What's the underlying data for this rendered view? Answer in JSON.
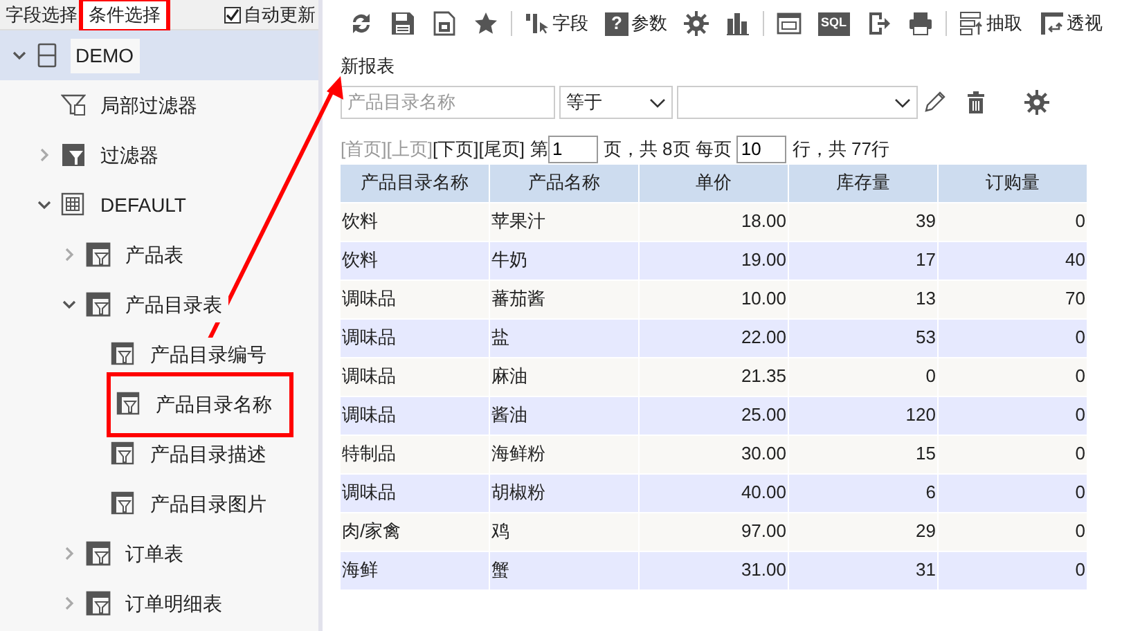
{
  "left_tabs": [
    {
      "label": "字段选择",
      "selected": false,
      "highlighted": false
    },
    {
      "label": "条件选择",
      "selected": true,
      "highlighted": true
    }
  ],
  "auto_update": {
    "label": "自动更新",
    "checked": true
  },
  "tree": [
    {
      "label": "DEMO",
      "kind": "database",
      "expanded": true,
      "selected": true,
      "children": [
        {
          "label": "局部过滤器",
          "kind": "local_filter",
          "selected": false
        },
        {
          "label": "过滤器",
          "kind": "filter",
          "expanded": false,
          "selected": false
        },
        {
          "label": "DEFAULT",
          "kind": "schema",
          "expanded": true,
          "selected": false,
          "children": [
            {
              "label": "产品表",
              "kind": "table",
              "expanded": false,
              "selected": false
            },
            {
              "label": "产品目录表",
              "kind": "table",
              "expanded": true,
              "selected": false,
              "children": [
                {
                  "label": "产品目录编号",
                  "kind": "field",
                  "selected": false
                },
                {
                  "label": "产品目录名称",
                  "kind": "field",
                  "selected": false,
                  "highlighted": true
                },
                {
                  "label": "产品目录描述",
                  "kind": "field",
                  "selected": false
                },
                {
                  "label": "产品目录图片",
                  "kind": "field",
                  "selected": false
                }
              ]
            },
            {
              "label": "订单表",
              "kind": "table",
              "expanded": false,
              "selected": false
            },
            {
              "label": "订单明细表",
              "kind": "table",
              "expanded": false,
              "selected": false
            }
          ]
        }
      ]
    }
  ],
  "toolbar": [
    {
      "kind": "refresh"
    },
    {
      "kind": "save"
    },
    {
      "kind": "save_as"
    },
    {
      "kind": "star"
    },
    {
      "kind": "separator"
    },
    {
      "kind": "fields",
      "label": "字段"
    },
    {
      "kind": "help",
      "label": "参数",
      "text": "?"
    },
    {
      "kind": "gear"
    },
    {
      "kind": "chart"
    },
    {
      "kind": "separator"
    },
    {
      "kind": "layout"
    },
    {
      "kind": "sql",
      "text": "SQL"
    },
    {
      "kind": "export"
    },
    {
      "kind": "print"
    },
    {
      "kind": "separator"
    },
    {
      "kind": "extract",
      "label": "抽取"
    },
    {
      "kind": "pivot",
      "label": "透视"
    }
  ],
  "report_title": "新报表",
  "condition": {
    "field_placeholder": "产品目录名称",
    "operator": "等于"
  },
  "pager": {
    "links": [
      {
        "label": "[首页]",
        "disabled": true
      },
      {
        "label": "[上页]",
        "disabled": true
      },
      {
        "label": "[下页]",
        "disabled": false
      },
      {
        "label": "[尾页]",
        "disabled": false
      }
    ],
    "page_prefix": "第",
    "page": "1",
    "page_suffix": "页，共 8页 每页",
    "rows_per_page": "10",
    "total": "行，共 77行"
  },
  "table": {
    "columns": [
      "产品目录名称",
      "产品名称",
      "单价",
      "库存量",
      "订购量"
    ],
    "rows": [
      [
        "饮料",
        "苹果汁",
        "18.00",
        "39",
        "0"
      ],
      [
        "饮料",
        "牛奶",
        "19.00",
        "17",
        "40"
      ],
      [
        "调味品",
        "蕃茄酱",
        "10.00",
        "13",
        "70"
      ],
      [
        "调味品",
        "盐",
        "22.00",
        "53",
        "0"
      ],
      [
        "调味品",
        "麻油",
        "21.35",
        "0",
        "0"
      ],
      [
        "调味品",
        "酱油",
        "25.00",
        "120",
        "0"
      ],
      [
        "特制品",
        "海鲜粉",
        "30.00",
        "15",
        "0"
      ],
      [
        "调味品",
        "胡椒粉",
        "40.00",
        "6",
        "0"
      ],
      [
        "肉/家禽",
        "鸡",
        "97.00",
        "29",
        "0"
      ],
      [
        "海鲜",
        "蟹",
        "31.00",
        "31",
        "0"
      ]
    ]
  }
}
